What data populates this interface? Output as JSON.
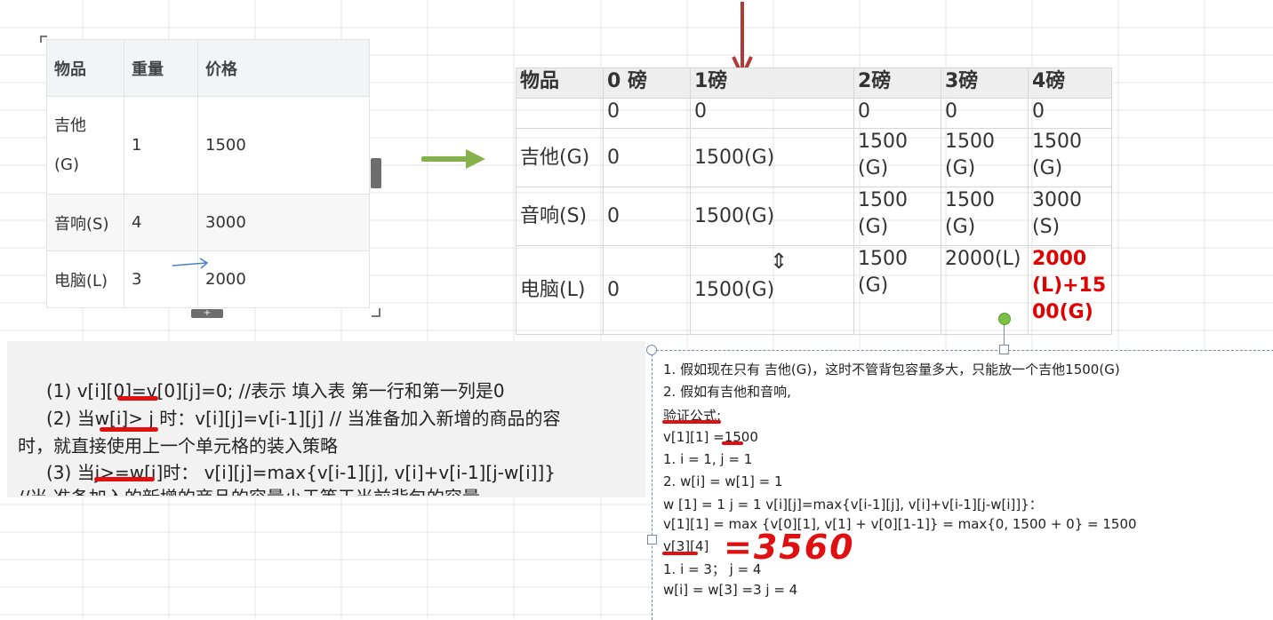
{
  "item_table": {
    "headers": [
      "物品",
      "重量",
      "价格"
    ],
    "rows": [
      {
        "item": "吉他",
        "item_suffix": "(G)",
        "weight": "1",
        "price": "1500"
      },
      {
        "item": "音响(S)",
        "item_suffix": "",
        "weight": "4",
        "price": "3000"
      },
      {
        "item": "电脑(L)",
        "item_suffix": "",
        "weight": "3",
        "price": "2000"
      }
    ],
    "collapse_handle": "+"
  },
  "dp_table": {
    "headers": [
      "物品",
      "0 磅",
      "1磅",
      "2磅",
      "3磅",
      "4磅"
    ],
    "rows": [
      [
        "",
        "0",
        "0",
        "0",
        "0",
        "0"
      ],
      [
        "吉他(G)",
        "0",
        "1500(G)",
        "1500(G)",
        "1500(G)",
        "1500(G)"
      ],
      [
        "音响(S)",
        "0",
        "1500(G)",
        "1500(G)",
        "1500(G)",
        "3000(S)"
      ],
      [
        "电脑(L)",
        "0",
        "1500(G)",
        "1500(G)",
        "2000(L)",
        "2000(L)+1500(G)"
      ]
    ],
    "highlight_color": "#e00000"
  },
  "formula_panel": {
    "line1": "(1)  v[i][0]=v[0][j]=0; //表示 填入表 第一行和第一列是0",
    "line2": "(2) 当w[i]> j 时：v[i][j]=v[i-1][j]  // 当准备加入新增的商品的容",
    "line3": "时，就直接使用上一个单元格的装入策略",
    "line4": "(3) 当j>=w[i]时：  v[i][j]=max{v[i-1][j], v[i]+v[i-1][j-w[i]]}",
    "line5": "//当 准备加入的新增的商品的容量小于等于当前背包的容量"
  },
  "notes": {
    "lines": [
      "1. 假如现在只有 吉他(G)，这时不管背包容量多大，只能放一个吉他1500(G)",
      "2. 假如有吉他和音响,",
      "验证公式:",
      "v[1][1] =1500",
      "1. i = 1, j = 1",
      "2. w[i] = w[1] = 1",
      "w [1] = 1   j = 1    v[i][j]=max{v[i-1][j], v[i]+v[i-1][j-w[i]]}：",
      "v[1][1] = max {v[0][1], v[1] + v[0][1-1]} = max{0, 1500 + 0} = 1500",
      "v[3][4]",
      "1. i = 3；  j = 4",
      "w[i] = w[3] =3 j = 4"
    ],
    "handwritten": "=3560"
  },
  "colors": {
    "arrow_green": "#86b04a",
    "arrow_red": "#b03a3a",
    "ink_red": "#e01010",
    "arrow_blue": "#4a7fd0"
  }
}
